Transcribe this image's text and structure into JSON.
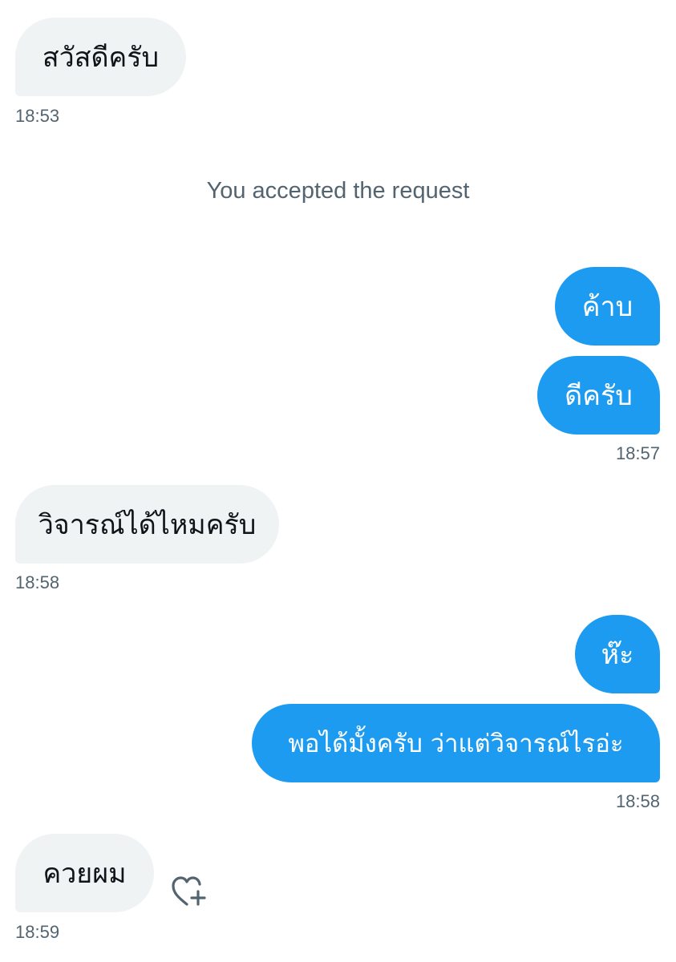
{
  "conversation": {
    "messages": [
      {
        "id": "m1",
        "direction": "incoming",
        "text": "สวัสดีครับ"
      },
      {
        "id": "m2",
        "direction": "outgoing",
        "text": "ค้าบ"
      },
      {
        "id": "m3",
        "direction": "outgoing",
        "text": "ดีครับ"
      },
      {
        "id": "m4",
        "direction": "incoming",
        "text": "วิจารณ์ได้ไหมครับ"
      },
      {
        "id": "m5",
        "direction": "outgoing",
        "text": "ห๊ะ"
      },
      {
        "id": "m6",
        "direction": "outgoing",
        "text": "พอได้มั้งครับ ว่าแต่วิจารณ์ไรอ่ะ"
      },
      {
        "id": "m7",
        "direction": "incoming",
        "text": "ควยผม"
      }
    ],
    "timestamps": {
      "t1": "18:53",
      "t2": "18:57",
      "t3": "18:58",
      "t4": "18:58",
      "t5": "18:59"
    },
    "system_notice": "You accepted the request",
    "reaction_icon": "heart-plus-icon"
  },
  "colors": {
    "outgoing_bubble": "#1d9bf0",
    "incoming_bubble": "#eff3f4",
    "meta_text": "#536471"
  }
}
